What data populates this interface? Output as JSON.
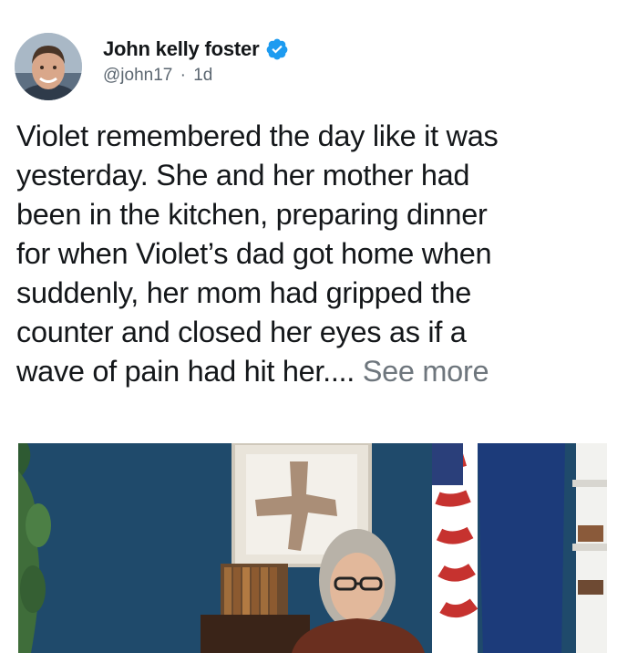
{
  "author": {
    "name": "John kelly foster",
    "handle": "@john17",
    "separator": "·",
    "time": "1d",
    "verified": true,
    "avatar_icon": "person-avatar"
  },
  "tweet": {
    "text_lines": [
      "Violet remembered the day like it was",
      "yesterday. She and her mother had",
      "been in the kitchen, preparing dinner",
      "for when Violet’s dad got home when",
      "suddenly, her mom had gripped the",
      "counter and closed her eyes as if a",
      "wave of pain had hit her...."
    ],
    "see_more": "See more"
  },
  "colors": {
    "verified_blue": "#1d9bf0",
    "muted_text": "#6e767d",
    "wall_blue": "#1f4a6b"
  },
  "media": {
    "icon": "photo-woman-at-desk-with-flags"
  }
}
